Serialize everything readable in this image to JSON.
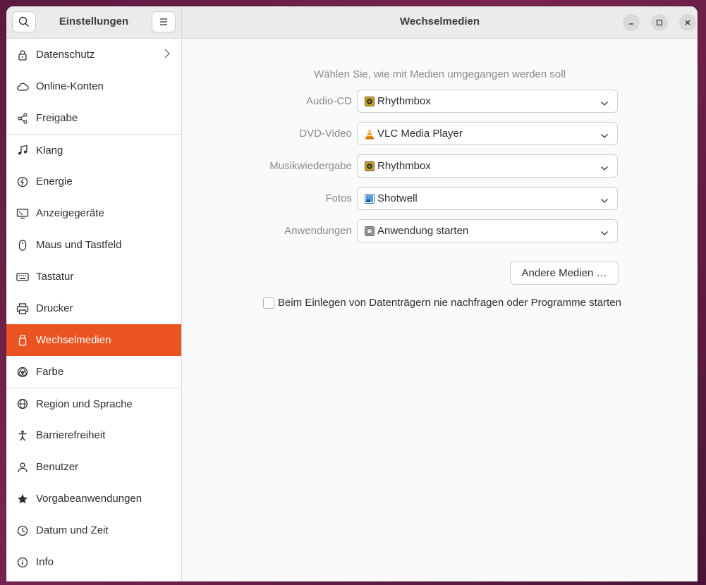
{
  "sidebar": {
    "title": "Einstellungen",
    "items": [
      {
        "label": "Datenschutz",
        "icon": "lock-icon"
      },
      {
        "label": "Online-Konten",
        "icon": "cloud-icon"
      },
      {
        "label": "Freigabe",
        "icon": "share-icon"
      },
      {
        "label": "Klang",
        "icon": "music-note-icon"
      },
      {
        "label": "Energie",
        "icon": "power-icon"
      },
      {
        "label": "Anzeigegeräte",
        "icon": "display-icon"
      },
      {
        "label": "Maus und Tastfeld",
        "icon": "mouse-icon"
      },
      {
        "label": "Tastatur",
        "icon": "keyboard-icon"
      },
      {
        "label": "Drucker",
        "icon": "printer-icon"
      },
      {
        "label": "Wechselmedien",
        "icon": "usb-drive-icon"
      },
      {
        "label": "Farbe",
        "icon": "color-icon"
      },
      {
        "label": "Region und Sprache",
        "icon": "globe-icon"
      },
      {
        "label": "Barrierefreiheit",
        "icon": "accessibility-icon"
      },
      {
        "label": "Benutzer",
        "icon": "user-icon"
      },
      {
        "label": "Vorgabeanwendungen",
        "icon": "star-icon"
      },
      {
        "label": "Datum und Zeit",
        "icon": "clock-icon"
      },
      {
        "label": "Info",
        "icon": "info-icon"
      }
    ],
    "active": "Wechselmedien"
  },
  "header": {
    "title": "Wechselmedien"
  },
  "main": {
    "hint": "Wählen Sie, wie mit Medien umgegangen werden soll",
    "rows": [
      {
        "label": "Audio-CD",
        "value": "Rhythmbox",
        "icon": "rhythmbox-icon"
      },
      {
        "label": "DVD-Video",
        "value": "VLC Media Player",
        "icon": "vlc-icon"
      },
      {
        "label": "Musikwiedergabe",
        "value": "Rhythmbox",
        "icon": "rhythmbox-icon"
      },
      {
        "label": "Fotos",
        "value": "Shotwell",
        "icon": "shotwell-icon"
      },
      {
        "label": "Anwendungen",
        "value": "Anwendung starten",
        "icon": "app-launch-icon"
      }
    ],
    "other_media_button": "Andere Medien …",
    "never_prompt_label": "Beim Einlegen von Datenträgern nie nachfragen oder Programme starten"
  },
  "colors": {
    "accent": "#e95420"
  }
}
